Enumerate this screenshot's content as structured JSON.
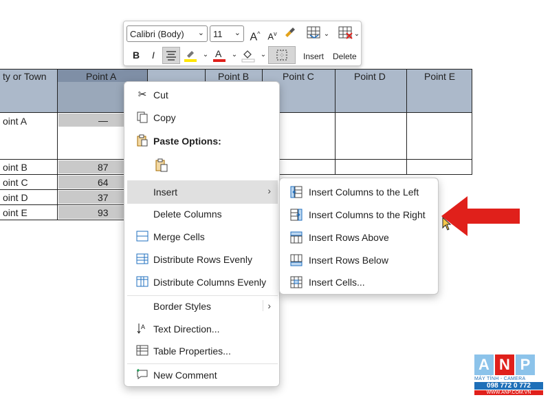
{
  "table": {
    "headers": [
      "ty or Town",
      "Point A",
      "",
      "Point B",
      "Point C",
      "Point D",
      "Point E"
    ],
    "rows": [
      {
        "label": "oint A",
        "value": "—"
      },
      {
        "label": "oint B",
        "value": "87"
      },
      {
        "label": "oint C",
        "value": "64"
      },
      {
        "label": "oint D",
        "value": "37"
      },
      {
        "label": "oint E",
        "value": "93"
      }
    ]
  },
  "mini_toolbar": {
    "font_name": "Calibri (Body)",
    "font_size": "11",
    "insert_label": "Insert",
    "delete_label": "Delete",
    "bold": "B",
    "italic": "I"
  },
  "context_menu": {
    "cut": "Cut",
    "copy": "Copy",
    "paste_options": "Paste Options:",
    "insert": "Insert",
    "delete_columns": "Delete Columns",
    "merge_cells": "Merge Cells",
    "distribute_rows": "Distribute Rows Evenly",
    "distribute_columns": "Distribute Columns Evenly",
    "border_styles": "Border Styles",
    "text_direction": "Text Direction...",
    "table_properties": "Table Properties...",
    "new_comment": "New Comment"
  },
  "insert_submenu": {
    "cols_left": "Insert Columns to the Left",
    "cols_right": "Insert Columns to the Right",
    "rows_above": "Insert Rows Above",
    "rows_below": "Insert Rows Below",
    "cells": "Insert Cells..."
  },
  "watermark": {
    "letters": [
      "A",
      "N",
      "P"
    ],
    "tagline": "MÁY TÍNH - CAMERA",
    "phone": "098 772 0 772",
    "site": "WWW.ANP.COM.VN"
  },
  "colors": {
    "header_fill": "#acb9ca",
    "highlight_red": "#e0201b",
    "accent_blue": "#1e6fb8"
  }
}
